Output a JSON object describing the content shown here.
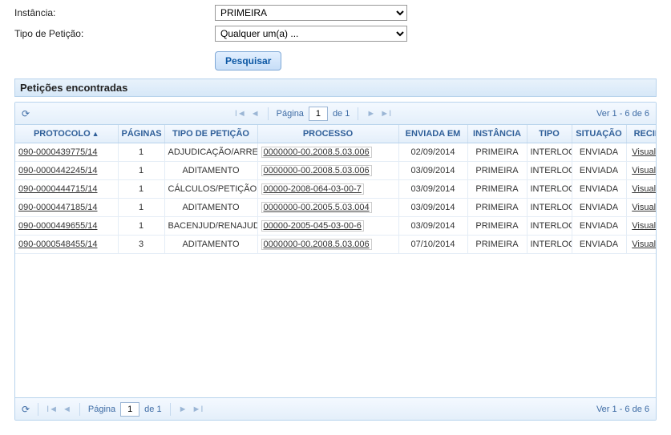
{
  "form": {
    "instancia_label": "Instância:",
    "instancia_value": "PRIMEIRA",
    "tipo_label": "Tipo de Petição:",
    "tipo_value": "Qualquer um(a) ...",
    "search_label": "Pesquisar"
  },
  "panel": {
    "title": "Petições encontradas"
  },
  "pager": {
    "page_word": "Página",
    "page_value": "1",
    "of_word": "de 1",
    "range": "Ver 1 - 6 de 6"
  },
  "columns": {
    "protocolo": "PROTOCOLO",
    "paginas": "PÁGINAS",
    "tipo": "TIPO DE PETIÇÃO",
    "processo": "PROCESSO",
    "enviada": "ENVIADA EM",
    "instancia": "INSTÂNCIA",
    "t": "TIPO",
    "situacao": "SITUAÇÃO",
    "recibo": "RECIBO"
  },
  "recibo_link_label": "Visualizar",
  "rows": [
    {
      "protocolo": "090-0000439775/14",
      "paginas": "1",
      "tipo": "ADJUDICAÇÃO/ARREMATAÇÃO",
      "processo": "0000000-00.2008.5.03.006",
      "enviada": "02/09/2014",
      "instancia": "PRIMEIRA",
      "t": "INTERLOCUTÓRIA",
      "situacao": "ENVIADA"
    },
    {
      "protocolo": "090-0000442245/14",
      "paginas": "1",
      "tipo": "ADITAMENTO",
      "processo": "0000000-00.2008.5.03.006",
      "enviada": "03/09/2014",
      "instancia": "PRIMEIRA",
      "t": "INTERLOCUTÓRIA",
      "situacao": "ENVIADA"
    },
    {
      "protocolo": "090-0000444715/14",
      "paginas": "1",
      "tipo": "CÁLCULOS/PETIÇÃO",
      "processo": "00000-2008-064-03-00-7",
      "enviada": "03/09/2014",
      "instancia": "PRIMEIRA",
      "t": "INTERLOCUTÓRIA",
      "situacao": "ENVIADA"
    },
    {
      "protocolo": "090-0000447185/14",
      "paginas": "1",
      "tipo": "ADITAMENTO",
      "processo": "0000000-00.2005.5.03.004",
      "enviada": "03/09/2014",
      "instancia": "PRIMEIRA",
      "t": "INTERLOCUTÓRIA",
      "situacao": "ENVIADA"
    },
    {
      "protocolo": "090-0000449655/14",
      "paginas": "1",
      "tipo": "BACENJUD/RENAJUD",
      "processo": "00000-2005-045-03-00-6",
      "enviada": "03/09/2014",
      "instancia": "PRIMEIRA",
      "t": "INTERLOCUTÓRIA",
      "situacao": "ENVIADA"
    },
    {
      "protocolo": "090-0000548455/14",
      "paginas": "3",
      "tipo": "ADITAMENTO",
      "processo": "0000000-00.2008.5.03.006",
      "enviada": "07/10/2014",
      "instancia": "PRIMEIRA",
      "t": "INTERLOCUTÓRIA",
      "situacao": "ENVIADA"
    }
  ]
}
